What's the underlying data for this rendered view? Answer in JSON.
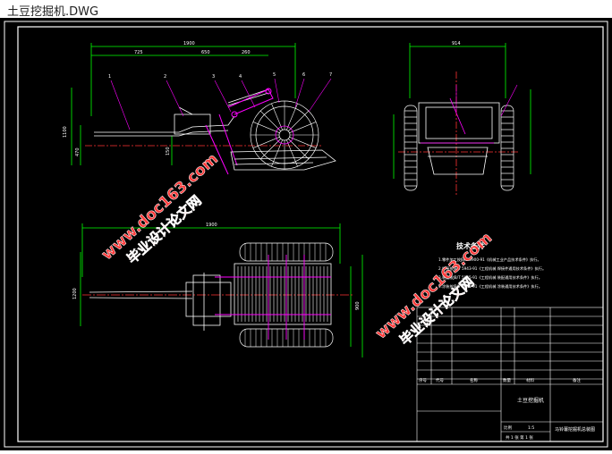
{
  "window": {
    "title": "土豆挖掘机.DWG"
  },
  "drawing": {
    "dims": {
      "overall_length": "1900",
      "len_a": "725",
      "len_b": "650",
      "len_c": "260",
      "side_width": "1500",
      "rear_width": "914",
      "height_total": "1100",
      "height_a": "470",
      "height_b": "150",
      "plan_length": "1900",
      "plan_width_a": "1200",
      "plan_width_b": "900"
    },
    "part_numbers": [
      "1",
      "2",
      "3",
      "4",
      "5",
      "6",
      "7"
    ],
    "tech_title": "技术条件",
    "tech_lines": [
      "1.零件加工按JB/T 5900-91《机械工业产品技术条件》执行。",
      "2.焊接按JB/T 5943-91《工程机械 焊接件通用技术条件》执行。",
      "3.装配按JB/T 5945-91《工程机械 装配通用技术条件》执行。",
      "4.涂装按JB/T 5946-91《工程机械 涂装通用技术条件》执行。"
    ],
    "watermark_url": "www.doc163.com",
    "watermark_brand": "毕业设计论文网",
    "title_block": {
      "label_seq": "序号",
      "label_code": "代号",
      "label_name": "名称",
      "label_qty": "数量",
      "label_material": "材料",
      "label_note": "备注",
      "drawing_name": "土豆挖掘机",
      "drawing_title": "马铃薯挖掘机总装图",
      "scale_label": "比例",
      "scale": "1:5",
      "sheet": "共 1 张 第 1 张"
    }
  }
}
